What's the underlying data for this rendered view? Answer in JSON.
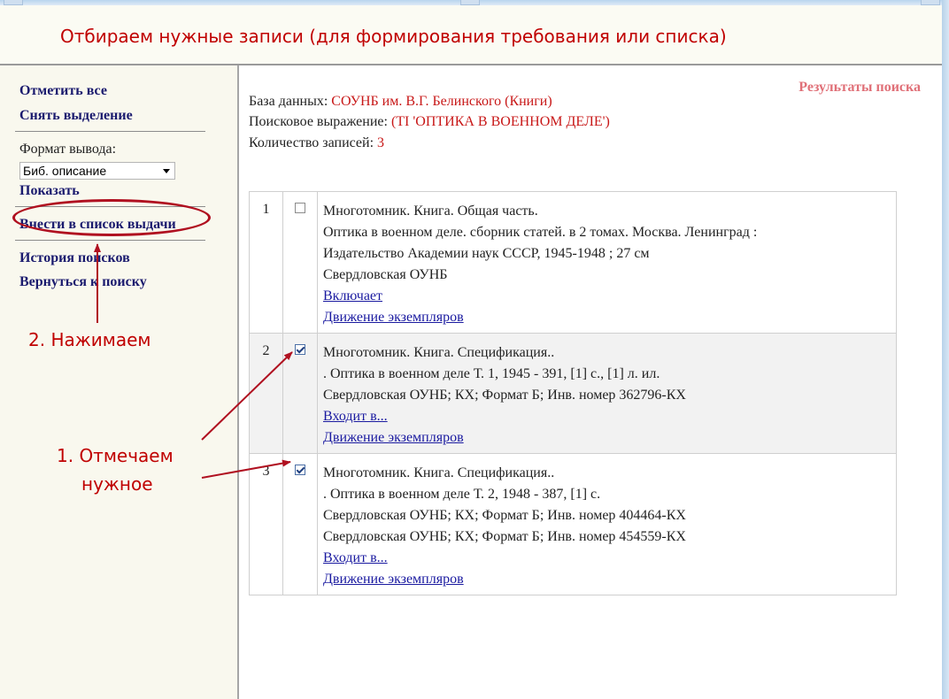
{
  "banner": {
    "title": "Отбираем нужные записи (для формирования требования или списка)"
  },
  "sidebar": {
    "mark_all": "Отметить все",
    "unmark": "Снять выделение",
    "format_label": "Формат вывода:",
    "format_value": "Биб. описание",
    "show": "Показать",
    "add_to_list": "Внести в список выдачи",
    "search_history": "История поисков",
    "back_to_search": "Вернуться к поиску"
  },
  "annotations": {
    "step2": "2. Нажимаем",
    "step1_line1": "1. Отмечаем",
    "step1_line2": "нужное"
  },
  "results": {
    "title": "Результаты поиска",
    "db_label": "База данных:",
    "db_value": "СОУНБ им. В.Г. Белинского (Книги)",
    "query_label": "Поисковое выражение:",
    "query_value": "(TI 'ОПТИКА В ВОЕННОМ ДЕЛЕ')",
    "count_label": "Количество записей:",
    "count_value": "3",
    "records": [
      {
        "num": "1",
        "checked": false,
        "lines": [
          "Многотомник. Книга. Общая часть.",
          "Оптика в военном деле. сборник статей. в 2 томах. Москва. Ленинград :",
          "Издательство Академии наук СССР, 1945-1948 ; 27 см",
          "Свердловская ОУНБ"
        ],
        "links": [
          "Включает",
          "Движение экземпляров"
        ]
      },
      {
        "num": "2",
        "checked": true,
        "lines": [
          "Многотомник. Книга. Спецификация..",
          ". Оптика в военном деле Т. 1, 1945 - 391, [1] с., [1] л. ил.",
          "Свердловская ОУНБ; КХ; Формат Б; Инв. номер 362796-КХ"
        ],
        "links": [
          "Входит в...",
          "Движение экземпляров"
        ]
      },
      {
        "num": "3",
        "checked": true,
        "lines": [
          "Многотомник. Книга. Спецификация..",
          ". Оптика в военном деле Т. 2, 1948 - 387, [1] с.",
          "Свердловская ОУНБ; КХ; Формат Б; Инв. номер 404464-КХ",
          "Свердловская ОУНБ; КХ; Формат Б; Инв. номер 454559-КХ"
        ],
        "links": [
          "Входит в...",
          "Движение экземпляров"
        ]
      }
    ]
  }
}
